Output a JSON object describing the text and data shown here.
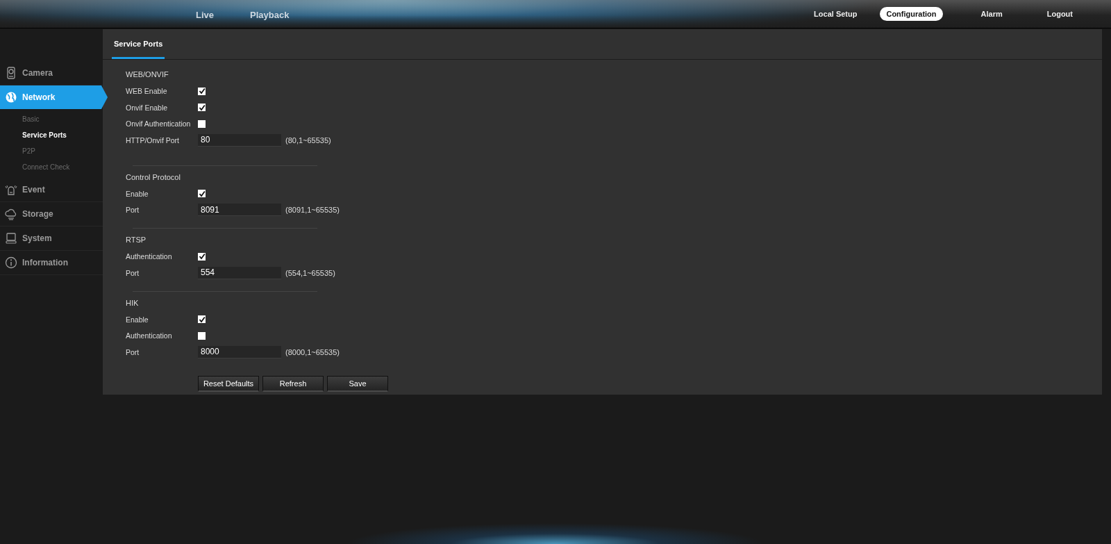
{
  "top_nav": {
    "main": [
      {
        "label": "Live",
        "selected": false
      },
      {
        "label": "Playback",
        "selected": false
      }
    ],
    "right": [
      {
        "label": "Local Setup",
        "selected": false
      },
      {
        "label": "Configuration",
        "selected": true
      },
      {
        "label": "Alarm",
        "selected": false
      },
      {
        "label": "Logout",
        "selected": false
      }
    ]
  },
  "sidebar": {
    "items": [
      {
        "label": "Camera",
        "selected": false
      },
      {
        "label": "Network",
        "selected": true,
        "children": [
          {
            "label": "Basic",
            "selected": false
          },
          {
            "label": "Service Ports",
            "selected": true
          },
          {
            "label": "P2P",
            "selected": false
          },
          {
            "label": "Connect Check",
            "selected": false
          }
        ]
      },
      {
        "label": "Event",
        "selected": false
      },
      {
        "label": "Storage",
        "selected": false
      },
      {
        "label": "System",
        "selected": false
      },
      {
        "label": "Information",
        "selected": false
      }
    ]
  },
  "tabs": [
    {
      "label": "Service Ports",
      "selected": true
    }
  ],
  "sections": [
    {
      "title": "WEB/ONVIF",
      "rows": [
        {
          "kind": "checkbox",
          "label": "WEB Enable",
          "checked": true
        },
        {
          "kind": "checkbox",
          "label": "Onvif Enable",
          "checked": true
        },
        {
          "kind": "checkbox",
          "label": "Onvif Authentication",
          "checked": false
        },
        {
          "kind": "port",
          "label": "HTTP/Onvif Port",
          "value": "80",
          "range": "(80,1~65535)"
        }
      ]
    },
    {
      "title": "Control Protocol",
      "rows": [
        {
          "kind": "checkbox",
          "label": "Enable",
          "checked": true
        },
        {
          "kind": "port",
          "label": "Port",
          "value": "8091",
          "range": "(8091,1~65535)"
        }
      ]
    },
    {
      "title": "RTSP",
      "rows": [
        {
          "kind": "checkbox",
          "label": "Authentication",
          "checked": true
        },
        {
          "kind": "port",
          "label": "Port",
          "value": "554",
          "range": "(554,1~65535)"
        }
      ]
    },
    {
      "title": "HIK",
      "rows": [
        {
          "kind": "checkbox",
          "label": "Enable",
          "checked": true
        },
        {
          "kind": "checkbox",
          "label": "Authentication",
          "checked": false
        },
        {
          "kind": "port",
          "label": "Port",
          "value": "8000",
          "range": "(8000,1~65535)"
        }
      ]
    }
  ],
  "buttons": [
    "Reset Defaults",
    "Refresh",
    "Save"
  ]
}
